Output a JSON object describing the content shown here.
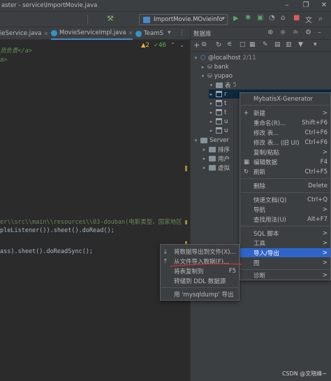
{
  "window": {
    "title": "aster - service\\ImportMovie.java"
  },
  "toolbar": {
    "run_config": "ImportMovie.MOvieinfo"
  },
  "editor": {
    "tabs": [
      "ieService.java",
      "MovieServiceImpl.java",
      "TeamS"
    ],
    "inspection": {
      "warnings": "▲2",
      "checks": "✓46"
    },
    "lines": [
      "员负责</a>",
      "a>",
      "er\\\\src\\\\main\\\\resources\\\\03-douban(电影类型、国家地区",
      "pleListener()).sheet().doRead();",
      "ass).sheet().doReadSync();"
    ]
  },
  "db_panel": {
    "title": "数据库",
    "tree": [
      {
        "label": "@localhost",
        "badge": "2/11"
      },
      {
        "label": "bank"
      },
      {
        "label": "yupao"
      },
      {
        "label": "表",
        "badge": "5"
      },
      {
        "label": "r"
      },
      {
        "label": "t"
      },
      {
        "label": "t"
      },
      {
        "label": "u"
      },
      {
        "label": "u"
      },
      {
        "label": "Server"
      },
      {
        "label": "排序"
      },
      {
        "label": "用户"
      },
      {
        "label": "虚拟"
      }
    ]
  },
  "context_menu": {
    "items": [
      {
        "label": "MybatisX-Generator",
        "shortcut": ""
      },
      {
        "label": "新建",
        "shortcut": ">"
      },
      {
        "label": "重命名(R)...",
        "shortcut": "Shift+F6"
      },
      {
        "label": "修改 表...",
        "shortcut": "Ctrl+F6"
      },
      {
        "label": "修改 表... (旧 UI)",
        "shortcut": "Ctrl+F6"
      },
      {
        "label": "复制/粘贴",
        "shortcut": ">"
      },
      {
        "label": "编辑数据",
        "shortcut": "F4"
      },
      {
        "label": "刷新",
        "shortcut": "Ctrl+F5"
      },
      {
        "label": "删除",
        "shortcut": "Delete"
      },
      {
        "label": "快速文档(Q)",
        "shortcut": "Ctrl+Q"
      },
      {
        "label": "导航",
        "shortcut": ">"
      },
      {
        "label": "查找用法(U)",
        "shortcut": "Alt+F7"
      },
      {
        "label": "SQL 脚本",
        "shortcut": ">"
      },
      {
        "label": "工具",
        "shortcut": ">"
      },
      {
        "label": "导入/导出",
        "shortcut": ">"
      },
      {
        "label": "图",
        "shortcut": ">"
      },
      {
        "label": "诊断",
        "shortcut": ">"
      }
    ]
  },
  "submenu": {
    "items": [
      {
        "label": "将数据导出到文件(X)...",
        "shortcut": ""
      },
      {
        "label": "从文件导入数据(F)...",
        "shortcut": ""
      },
      {
        "label": "将表复制到",
        "shortcut": "F5"
      },
      {
        "label": "转储到 DDL 数据源",
        "shortcut": ""
      },
      {
        "label": "用 'mysqldump' 导出",
        "shortcut": ""
      }
    ]
  },
  "watermark": "CSDN @文晓峰~",
  "colors": {
    "highlight": "#2f65ca",
    "annotation": "#e0303a",
    "accent": "#4a88c7"
  }
}
